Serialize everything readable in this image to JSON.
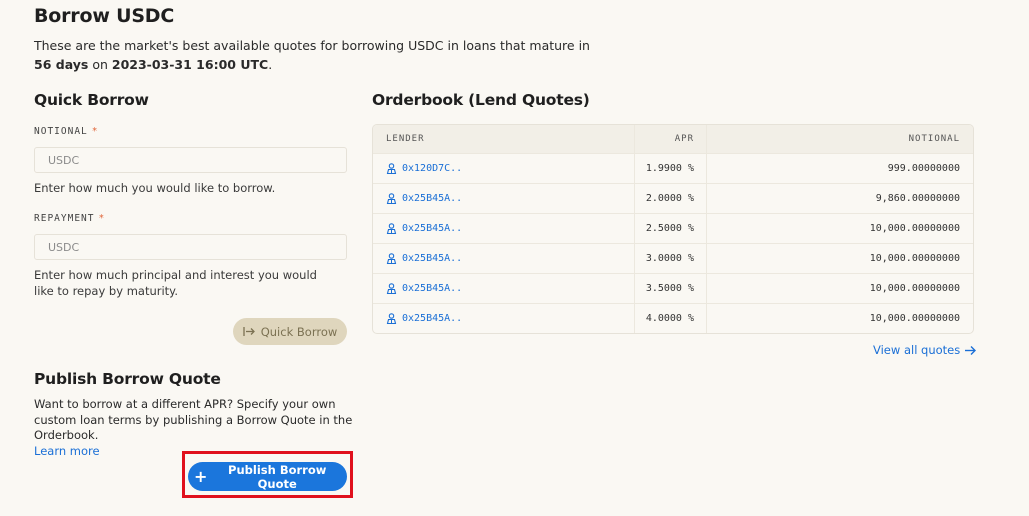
{
  "page": {
    "title": "Borrow USDC",
    "intro_prefix": "These are the market's best available quotes for borrowing USDC in loans that mature in ",
    "intro_days": "56 days",
    "intro_on": " on ",
    "intro_date": "2023-03-31 16:00 UTC",
    "intro_end": "."
  },
  "quick_borrow": {
    "title": "Quick Borrow",
    "notional_label": "NOTIONAL",
    "notional_placeholder": "USDC",
    "notional_help": "Enter how much you would like to borrow.",
    "repayment_label": "REPAYMENT",
    "repayment_placeholder": "USDC",
    "repayment_help": "Enter how much principal and interest you would like to repay by maturity.",
    "required_mark": "*",
    "button_label": "Quick Borrow",
    "button_icon": "arrow-into-bar-icon"
  },
  "publish": {
    "title": "Publish Borrow Quote",
    "description": "Want to borrow at a different APR? Specify your own custom loan terms by publishing a Borrow Quote in the Orderbook.",
    "learn_more": "Learn more",
    "button_label": "Publish Borrow Quote",
    "button_icon": "+",
    "highlight_color": "#e0101c"
  },
  "orderbook": {
    "title": "Orderbook (Lend Quotes)",
    "columns": {
      "lender": "LENDER",
      "apr": "APR",
      "notional": "NOTIONAL"
    },
    "rows": [
      {
        "lender": "0x120D7C..",
        "apr": "1.9900 %",
        "notional": "999.00000000"
      },
      {
        "lender": "0x25B45A..",
        "apr": "2.0000 %",
        "notional": "9,860.00000000"
      },
      {
        "lender": "0x25B45A..",
        "apr": "2.5000 %",
        "notional": "10,000.00000000"
      },
      {
        "lender": "0x25B45A..",
        "apr": "3.0000 %",
        "notional": "10,000.00000000"
      },
      {
        "lender": "0x25B45A..",
        "apr": "3.5000 %",
        "notional": "10,000.00000000"
      },
      {
        "lender": "0x25B45A..",
        "apr": "4.0000 %",
        "notional": "10,000.00000000"
      }
    ],
    "view_all": "View all quotes"
  },
  "colors": {
    "accent": "#1b76dc",
    "background": "#faf8f3",
    "quick_button": "#dfd6bd"
  }
}
